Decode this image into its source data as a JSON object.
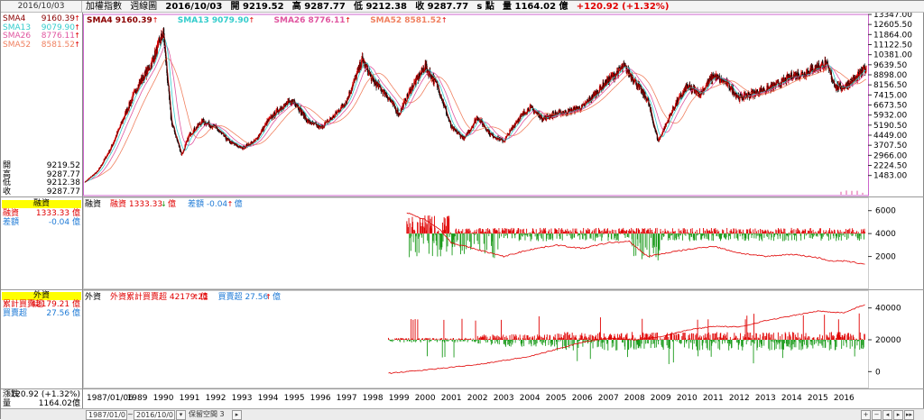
{
  "top": {
    "left_date": "2016/10/03",
    "index_name": "加權指數",
    "period": "週線圖",
    "date": "2016/10/03",
    "open": "開 9219.52",
    "high": "高 9287.77",
    "low": "低 9212.38",
    "close": "收 9287.77",
    "close_unit": "s 點",
    "volume": "量 1164.02 億",
    "change": "+120.92 (+1.32%)"
  },
  "sma_left": [
    {
      "label": "SMA4",
      "value": "9160.39",
      "color": "#8b0000"
    },
    {
      "label": "SMA13",
      "value": "9079.90",
      "color": "#33cccc"
    },
    {
      "label": "SMA26",
      "value": "8776.11",
      "color": "#e055a0"
    },
    {
      "label": "SMA52",
      "value": "8581.52",
      "color": "#f08060"
    }
  ],
  "sma_top": [
    {
      "text": "SMA4 9160.39",
      "color": "#8b0000"
    },
    {
      "text": "SMA13 9079.90",
      "color": "#33cccc"
    },
    {
      "text": "SMA26 8776.11",
      "color": "#e055a0"
    },
    {
      "text": "SMA52 8581.52",
      "color": "#f08060"
    }
  ],
  "ohlc_left": [
    {
      "label": "開",
      "value": "9219.52"
    },
    {
      "label": "高",
      "value": "9287.77"
    },
    {
      "label": "低",
      "value": "9212.38"
    },
    {
      "label": "收",
      "value": "9287.77"
    }
  ],
  "margin": {
    "header": "融資",
    "rows": [
      {
        "label": "融資",
        "value": "1333.33 億",
        "color": "#e00000"
      },
      {
        "label": "差額",
        "value": "-0.04 億",
        "color": "#1e7ad6"
      }
    ],
    "pane_title": "融資",
    "legend1": "融資 1333.33",
    "legend1_unit": "億",
    "legend2": "差額 -0.04",
    "legend2_unit": "億"
  },
  "foreign": {
    "header": "外資",
    "rows": [
      {
        "label": "累計買賣超",
        "value": "42179.21 億",
        "color": "#e00000"
      },
      {
        "label": "買賣超",
        "value": "27.56 億",
        "color": "#1e7ad6"
      }
    ],
    "pane_title": "外資",
    "legend1": "外資累計買賣超 42179.21",
    "legend1_unit": "億",
    "legend2": "買賣超 27.56",
    "legend2_unit": "億"
  },
  "bottom_left": [
    {
      "label": "漲跌",
      "value": "120.92 (+1.32%)"
    },
    {
      "label": "量",
      "value": "1164.02億"
    }
  ],
  "bottombar": {
    "range_start": "1987/01/0",
    "range_end": "2016/10/0",
    "keep_label": "保留空間 3"
  },
  "chart_data": [
    {
      "type": "line",
      "title": "加權指數 週線圖",
      "ylim": [
        0,
        13347
      ],
      "y_ticks": [
        "13347.00",
        "12605.50",
        "11864.00",
        "11122.50",
        "10381.00",
        "9639.50",
        "8898.00",
        "8156.50",
        "7415.00",
        "6673.50",
        "5932.00",
        "5190.50",
        "4449.00",
        "3707.50",
        "2966.00",
        "2224.50",
        "1483.00"
      ],
      "x_labels": [
        "1987/01/06",
        "1989",
        "1990",
        "1991",
        "1992",
        "1993",
        "1994",
        "1995",
        "1996",
        "1997",
        "1998",
        "1999",
        "2000",
        "2001",
        "2002",
        "2003",
        "2004",
        "2005",
        "2006",
        "2007",
        "2008",
        "2009",
        "2010",
        "2011",
        "2012",
        "2013",
        "2014",
        "2015",
        "2016"
      ],
      "x": [
        1987.0,
        1987.5,
        1988.0,
        1988.5,
        1989.0,
        1989.5,
        1990.0,
        1990.3,
        1990.7,
        1991.0,
        1991.5,
        1992.0,
        1992.5,
        1993.0,
        1993.5,
        1994.0,
        1994.5,
        1995.0,
        1995.5,
        1996.0,
        1996.5,
        1997.0,
        1997.6,
        1998.0,
        1998.5,
        1999.0,
        1999.5,
        2000.0,
        2000.5,
        2001.0,
        2001.5,
        2002.0,
        2002.5,
        2003.0,
        2003.5,
        2004.0,
        2004.5,
        2005.0,
        2005.5,
        2006.0,
        2006.5,
        2007.0,
        2007.6,
        2008.0,
        2008.5,
        2008.9,
        2009.5,
        2010.0,
        2010.5,
        2011.0,
        2011.5,
        2012.0,
        2012.5,
        2013.0,
        2013.5,
        2014.0,
        2014.5,
        2015.0,
        2015.3,
        2015.7,
        2016.0,
        2016.5,
        2016.75
      ],
      "series": [
        {
          "name": "加權指數",
          "values": [
            1000,
            1800,
            3500,
            5800,
            8000,
            9500,
            12000,
            5500,
            3000,
            4500,
            5500,
            5000,
            4000,
            3500,
            4000,
            5500,
            6500,
            7000,
            5500,
            5000,
            5800,
            7000,
            10000,
            8500,
            7500,
            6000,
            8000,
            9500,
            8000,
            5000,
            4200,
            5800,
            4500,
            4000,
            5500,
            6500,
            5700,
            6000,
            6200,
            6500,
            7500,
            8500,
            9500,
            8500,
            7000,
            4000,
            6500,
            8000,
            7500,
            8800,
            8300,
            7200,
            7500,
            7800,
            8200,
            8800,
            9000,
            9500,
            9700,
            8000,
            8000,
            8700,
            9288
          ]
        }
      ]
    },
    {
      "type": "bar",
      "title": "融資",
      "ylim": [
        0,
        7000
      ],
      "y_ticks": [
        "6000",
        "4000",
        "2000"
      ]
    },
    {
      "type": "bar",
      "title": "外資",
      "ylim": [
        -10000,
        50000
      ],
      "y_ticks": [
        "40000",
        "20000",
        "0"
      ]
    }
  ]
}
